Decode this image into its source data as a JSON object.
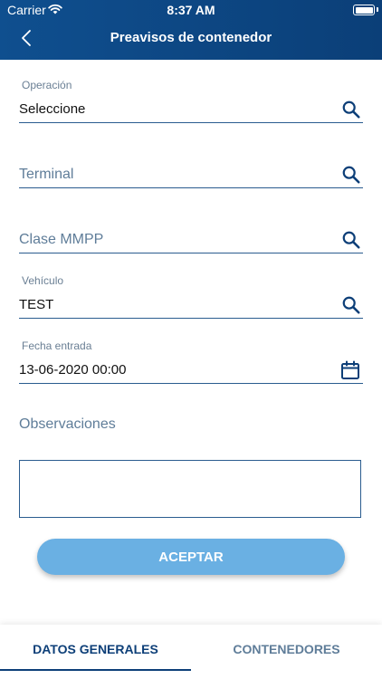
{
  "status_bar": {
    "carrier": "Carrier",
    "time": "8:37 AM"
  },
  "header": {
    "title": "Preavisos de contenedor"
  },
  "form": {
    "operacion": {
      "label": "Operación",
      "value": "Seleccione",
      "icon": "search-icon"
    },
    "terminal": {
      "placeholder": "Terminal",
      "icon": "search-icon"
    },
    "clase_mmpp": {
      "placeholder": "Clase MMPP",
      "icon": "search-icon"
    },
    "vehiculo": {
      "label": "Vehículo",
      "value": "TEST",
      "icon": "search-icon"
    },
    "fecha_entrada": {
      "label": "Fecha entrada",
      "value": "13-06-2020 00:00",
      "icon": "calendar-icon"
    },
    "observaciones": {
      "label": "Observaciones",
      "value": ""
    }
  },
  "actions": {
    "accept_label": "ACEPTAR"
  },
  "tabs": [
    {
      "label": "DATOS GENERALES",
      "active": true
    },
    {
      "label": "CONTENEDORES",
      "active": false
    }
  ],
  "colors": {
    "header": "#0f4f8f",
    "accent": "#0d3f78",
    "button": "#6ab0e3"
  }
}
